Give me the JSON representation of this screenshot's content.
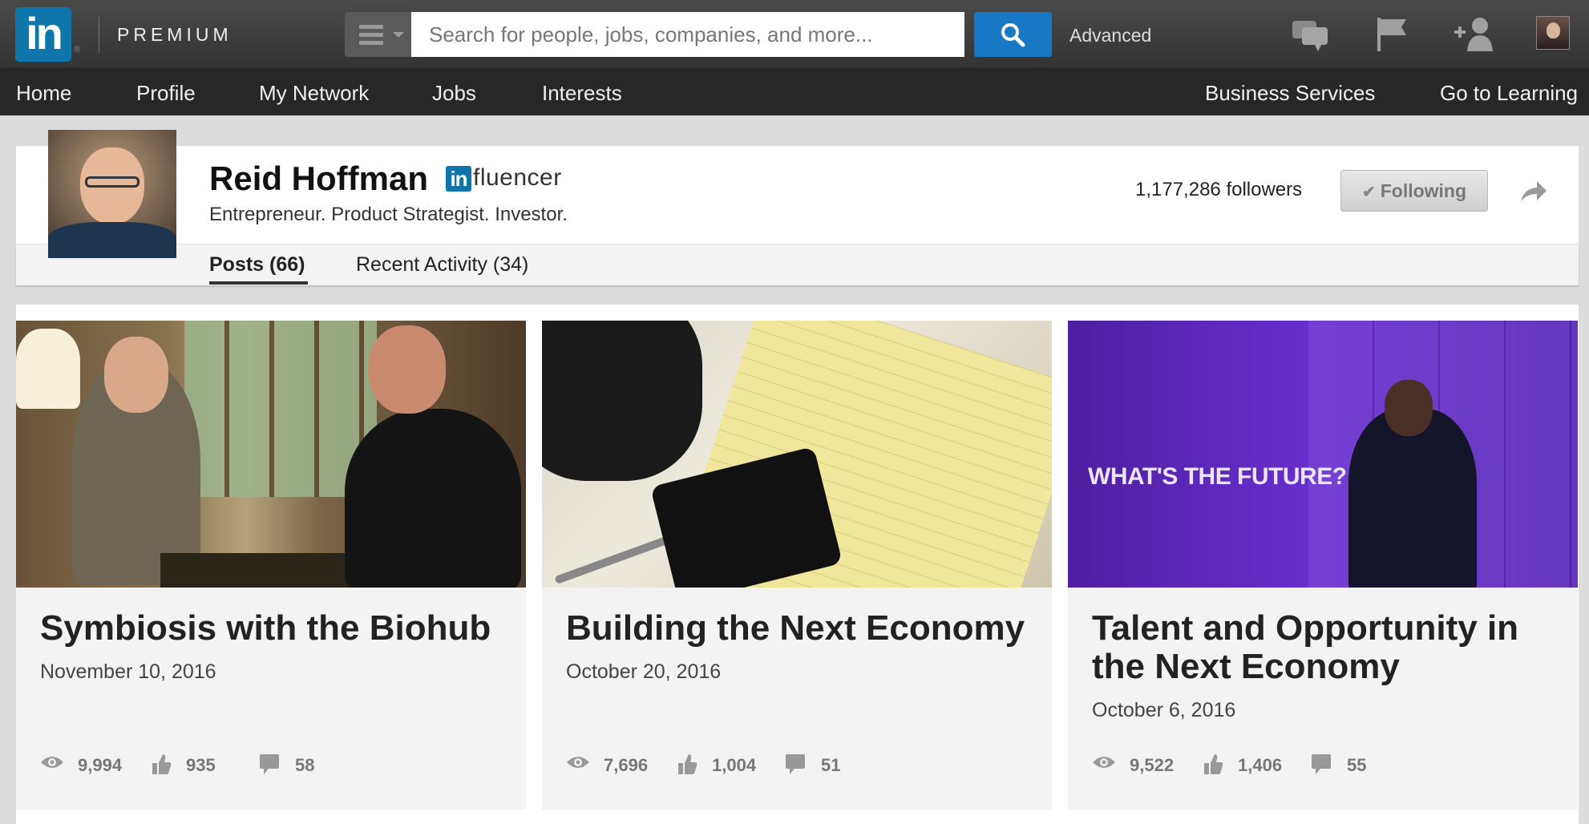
{
  "topbar": {
    "logo_text": "in",
    "logo_reg": "®",
    "premium_label": "PREMIUM",
    "search_placeholder": "Search for people, jobs, companies, and more...",
    "advanced_label": "Advanced",
    "icons": [
      "menu-icon",
      "search-icon",
      "messages-icon",
      "notifications-flag-icon",
      "add-connection-icon",
      "account-avatar"
    ]
  },
  "nav": {
    "items": [
      "Home",
      "Profile",
      "My Network",
      "Jobs",
      "Interests"
    ],
    "right_items": [
      "Business Services",
      "Go to Learning"
    ]
  },
  "profile": {
    "name": "Reid Hoffman",
    "badge_in": "in",
    "badge_text": "fluencer",
    "headline": "Entrepreneur. Product Strategist. Investor.",
    "followers": "1,177,286 followers",
    "following_label": "Following",
    "tabs": [
      "Posts (66)",
      "Recent Activity (34)"
    ]
  },
  "posts": [
    {
      "title": "Symbiosis with the Biohub",
      "date": "November 10, 2016",
      "views": "9,994",
      "likes": "935",
      "comments": "58"
    },
    {
      "title": "Building the Next Economy",
      "date": "October 20, 2016",
      "views": "7,696",
      "likes": "1,004",
      "comments": "51"
    },
    {
      "title": "Talent and Opportunity in the Next Economy",
      "date": "October 6, 2016",
      "views": "9,522",
      "likes": "1,406",
      "comments": "55",
      "image_text": "WHAT'S THE FUTURE?"
    }
  ],
  "colors": {
    "brand_blue": "#0e76a8",
    "search_button": "#1978c6",
    "topbar": "#3a3a3a",
    "navbar": "#272727"
  }
}
